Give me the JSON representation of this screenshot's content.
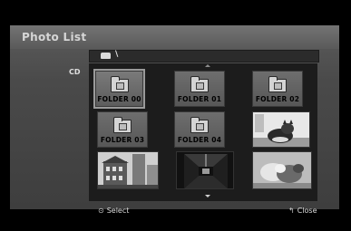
{
  "header": {
    "title": "Photo List"
  },
  "sidebar": {
    "source_label": "CD"
  },
  "path": {
    "text": "\\",
    "icon": "folder-icon"
  },
  "grid": {
    "items": [
      {
        "type": "folder",
        "label": "FOLDER 00",
        "selected": true
      },
      {
        "type": "folder",
        "label": "FOLDER 01"
      },
      {
        "type": "folder",
        "label": "FOLDER 02"
      },
      {
        "type": "folder",
        "label": "FOLDER 03"
      },
      {
        "type": "folder",
        "label": "FOLDER 04"
      },
      {
        "type": "photo",
        "subject": "cat"
      },
      {
        "type": "photo",
        "subject": "building"
      },
      {
        "type": "photo",
        "subject": "corridor"
      },
      {
        "type": "photo",
        "subject": "cats"
      }
    ]
  },
  "footer": {
    "select_icon": "enter-icon",
    "select_label": "Select",
    "close_icon": "return-icon",
    "close_label": "Close"
  }
}
